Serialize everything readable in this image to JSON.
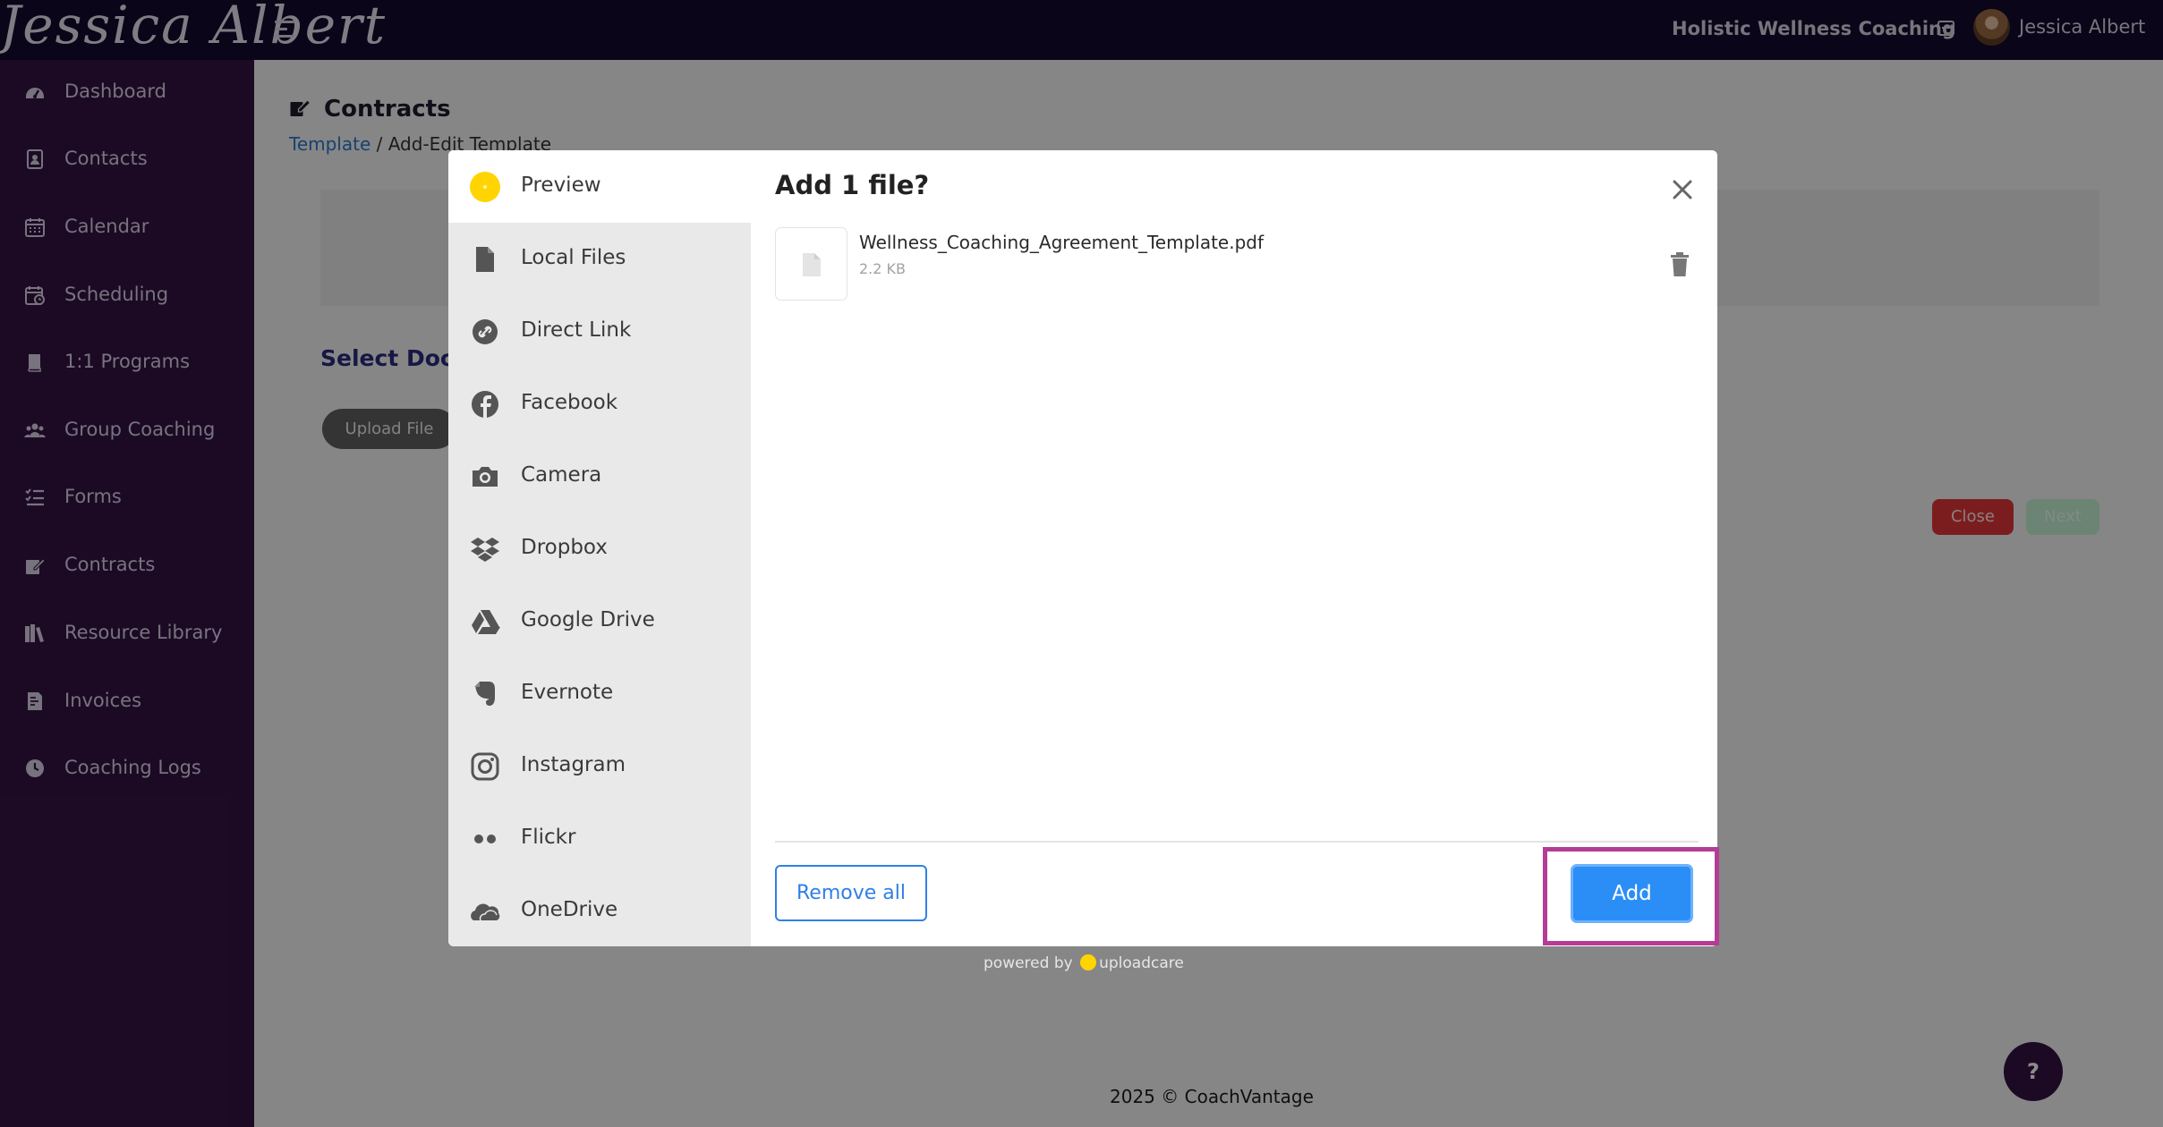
{
  "header": {
    "logo_text": "Jessica Albert",
    "business_name": "Holistic Wellness Coaching",
    "user_name": "Jessica Albert"
  },
  "sidebar": {
    "items": [
      {
        "label": "Dashboard",
        "icon": "dashboard-icon"
      },
      {
        "label": "Contacts",
        "icon": "contacts-icon"
      },
      {
        "label": "Calendar",
        "icon": "calendar-icon"
      },
      {
        "label": "Scheduling",
        "icon": "scheduling-icon"
      },
      {
        "label": "1:1 Programs",
        "icon": "book-icon"
      },
      {
        "label": "Group Coaching",
        "icon": "group-icon"
      },
      {
        "label": "Forms",
        "icon": "forms-icon"
      },
      {
        "label": "Contracts",
        "icon": "contract-icon"
      },
      {
        "label": "Resource Library",
        "icon": "library-icon"
      },
      {
        "label": "Invoices",
        "icon": "invoice-icon"
      },
      {
        "label": "Coaching Logs",
        "icon": "clock-icon"
      }
    ]
  },
  "page": {
    "title": "Contracts",
    "breadcrumb_link": "Template",
    "breadcrumb_separator": " / ",
    "breadcrumb_current": "Add-Edit Template",
    "section_heading": "Select Docu",
    "upload_button": "Upload File",
    "close_button": "Close",
    "next_button": "Next",
    "footer": "2025 © CoachVantage",
    "help_button": "?"
  },
  "dialog": {
    "title": "Add 1 file?",
    "sources": [
      {
        "label": "Preview",
        "icon": "preview-dot-icon"
      },
      {
        "label": "Local Files",
        "icon": "file-icon"
      },
      {
        "label": "Direct Link",
        "icon": "link-icon"
      },
      {
        "label": "Facebook",
        "icon": "facebook-icon"
      },
      {
        "label": "Camera",
        "icon": "camera-icon"
      },
      {
        "label": "Dropbox",
        "icon": "dropbox-icon"
      },
      {
        "label": "Google Drive",
        "icon": "google-drive-icon"
      },
      {
        "label": "Evernote",
        "icon": "evernote-icon"
      },
      {
        "label": "Instagram",
        "icon": "instagram-icon"
      },
      {
        "label": "Flickr",
        "icon": "flickr-icon"
      },
      {
        "label": "OneDrive",
        "icon": "onedrive-icon"
      }
    ],
    "file": {
      "name": "Wellness_Coaching_Agreement_Template.pdf",
      "size": "2.2 KB"
    },
    "remove_all_button": "Remove all",
    "add_button": "Add",
    "powered_by": "powered by",
    "powered_by_brand": "uploadcare"
  },
  "colors": {
    "topbar": "#140a2e",
    "sidebar": "#341344",
    "accent_blue": "#2b8ef7",
    "highlight": "#b43c96",
    "uploadcare_yellow": "#ffd400"
  }
}
